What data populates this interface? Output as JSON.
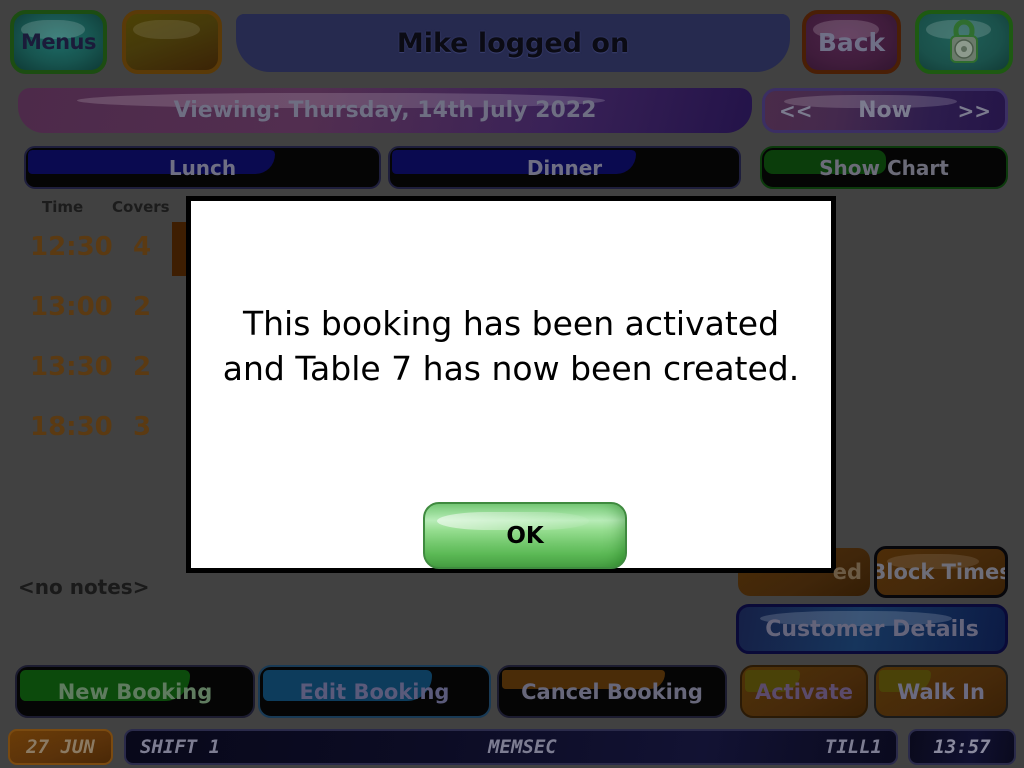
{
  "header": {
    "menus_label": "Menus",
    "blank_button_label": "",
    "title": "Mike logged on",
    "back_label": "Back",
    "lock_icon": "padlock-icon"
  },
  "datebar": {
    "viewing_label": "Viewing: Thursday, 14th July 2022",
    "prev_label": "<<",
    "now_label": "Now",
    "next_label": ">>"
  },
  "tabs": {
    "lunch": "Lunch",
    "dinner": "Dinner",
    "show_chart": "Show Chart"
  },
  "bookings": {
    "col_time": "Time",
    "col_covers": "Covers",
    "rows": [
      {
        "time": "12:30",
        "covers": "4",
        "selected": true
      },
      {
        "time": "13:00",
        "covers": "2",
        "selected": false
      },
      {
        "time": "13:30",
        "covers": "2",
        "selected": false
      },
      {
        "time": "18:30",
        "covers": "3",
        "selected": false
      }
    ],
    "notes": "<no notes>"
  },
  "side_actions": {
    "seated_label": "ed",
    "block_times_label": "Block Times",
    "customer_details_label": "Customer Details"
  },
  "bottom_actions": {
    "new_booking": "New Booking",
    "edit_booking": "Edit Booking",
    "cancel_booking": "Cancel Booking",
    "activate": "Activate",
    "walk_in": "Walk In"
  },
  "statusbar": {
    "date": "27 JUN",
    "shift": "SHIFT 1",
    "operator": "MEMSEC",
    "till": "TILL1",
    "time": "13:57"
  },
  "dialog": {
    "message_line1": "This booking has been activated",
    "message_line2": "and Table 7 has now been created.",
    "ok_label": "OK"
  },
  "colors": {
    "background": "#414141",
    "dialog_bg": "#ffffff",
    "dialog_border": "#000000",
    "ok_button_green": "#7fd07f",
    "title_banner": "#262a4f",
    "selected_row": "#3e1e02"
  }
}
